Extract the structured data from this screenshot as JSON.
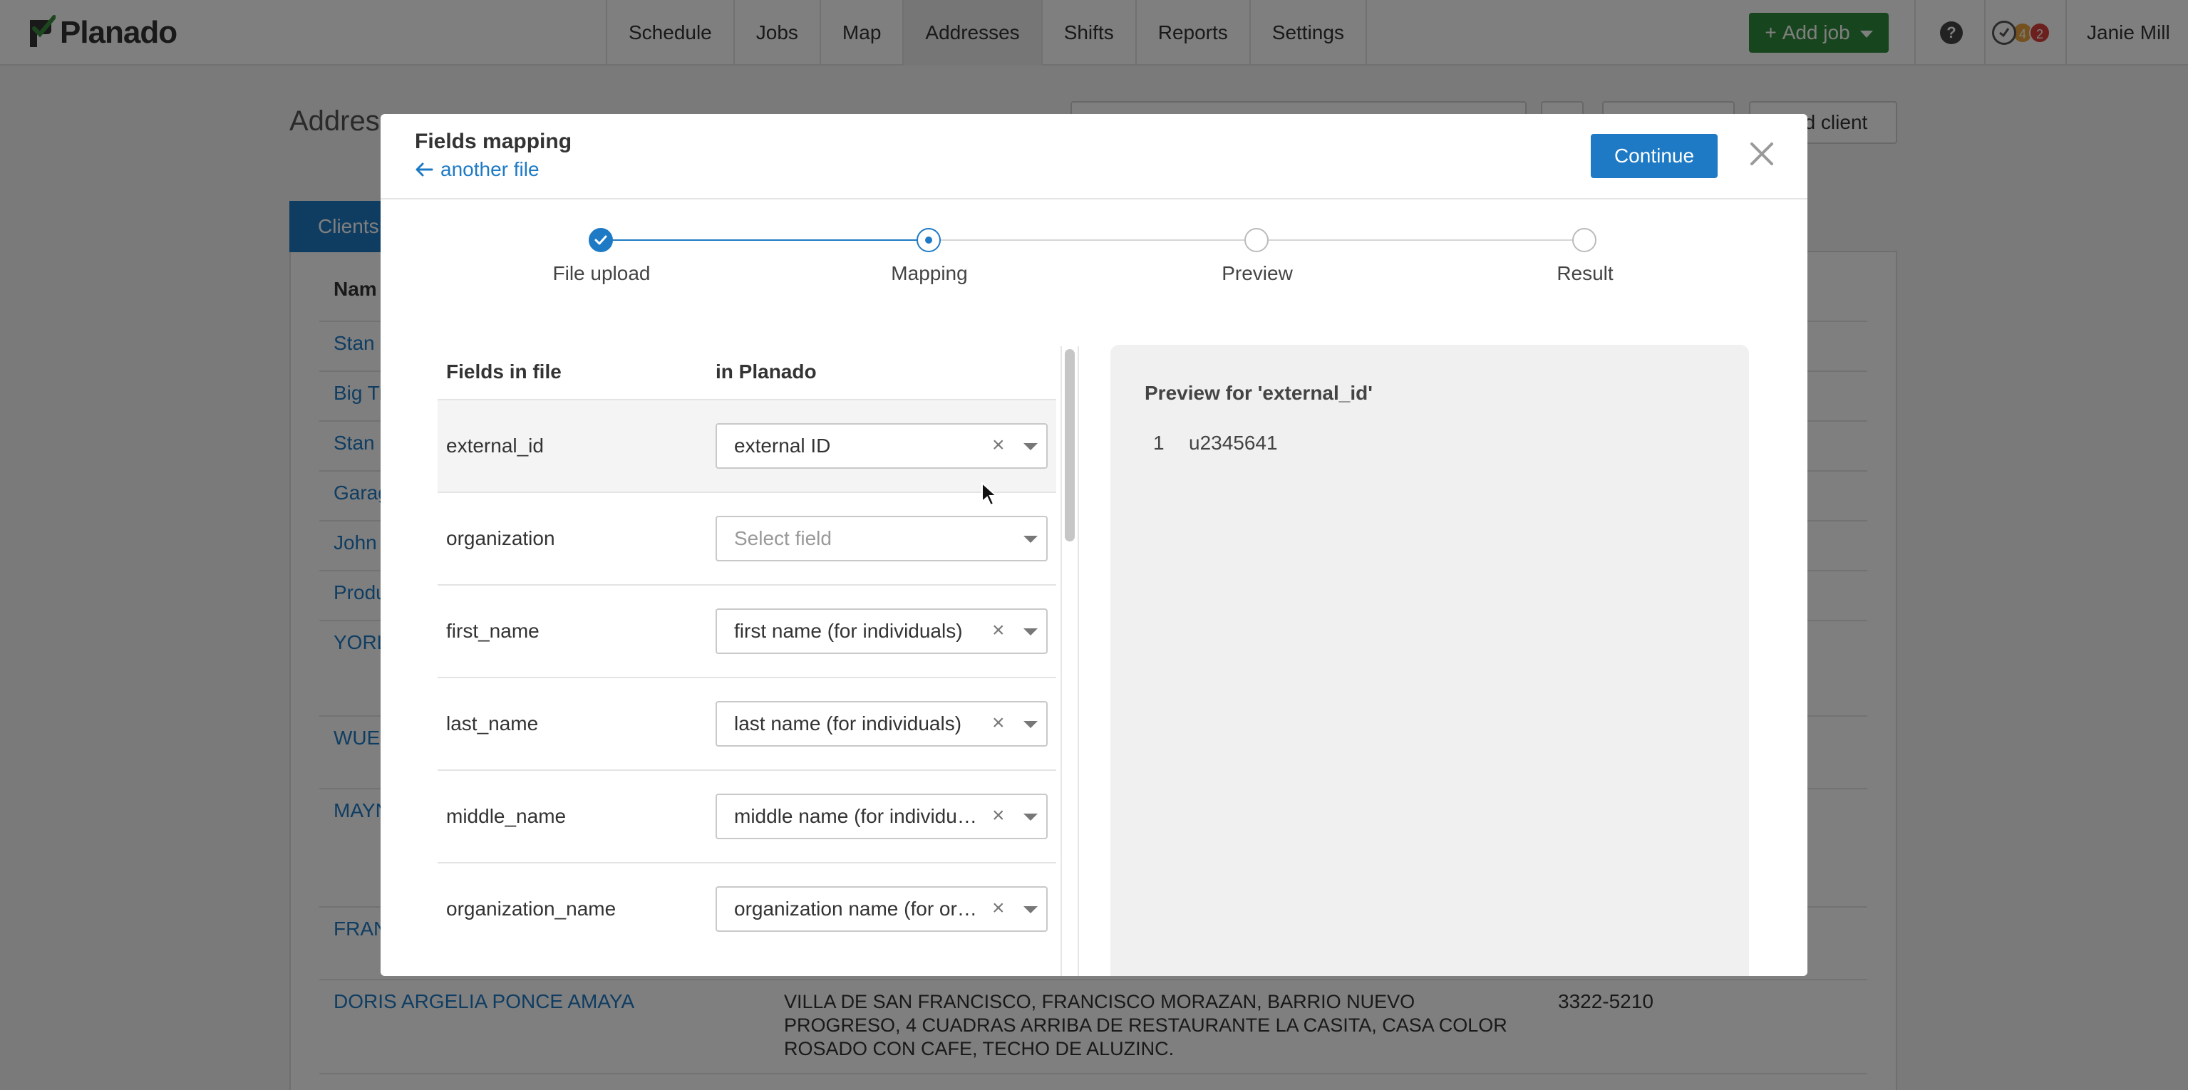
{
  "app": {
    "brand": "Planado"
  },
  "navbar": {
    "tabs": [
      "Schedule",
      "Jobs",
      "Map",
      "Addresses",
      "Shifts",
      "Reports",
      "Settings"
    ],
    "active_tab": "Addresses",
    "add_job_label": "Add job",
    "add_job_icon": "+",
    "help_icon": "?",
    "status_badges": {
      "orange": "4",
      "red": "2"
    },
    "user_name": "Janie Mill"
  },
  "background": {
    "page_title": "Addres",
    "add_client_label": "dd client",
    "clients_tab": "Clients",
    "table_header": "Nam",
    "rows": [
      {
        "name": "Stan I",
        "address": "",
        "phone": ""
      },
      {
        "name": "Big Tr",
        "address": "",
        "phone": ""
      },
      {
        "name": "Stan C",
        "address": "",
        "phone": ""
      },
      {
        "name": "Garag",
        "address": "",
        "phone": ""
      },
      {
        "name": "John I",
        "address": "",
        "phone": ""
      },
      {
        "name": "Produ",
        "address": "",
        "phone": ""
      },
      {
        "name": "YORL",
        "address": "",
        "phone": ""
      },
      {
        "name": "WUEN",
        "address": "",
        "phone": ""
      },
      {
        "name": "MAYN",
        "address": "",
        "phone": ""
      },
      {
        "name": "FRAN",
        "address": "",
        "phone": ""
      },
      {
        "name": "DORIS ARGELIA PONCE AMAYA",
        "address": "VILLA DE SAN FRANCISCO, FRANCISCO MORAZAN, BARRIO NUEVO PROGRESO, 4 CUADRAS ARRIBA DE RESTAURANTE LA CASITA, CASA COLOR ROSADO CON CAFE, TECHO DE ALUZINC.",
        "phone": "3322-5210"
      }
    ]
  },
  "modal": {
    "title": "Fields mapping",
    "back_link": "another file",
    "continue_label": "Continue",
    "steps": [
      {
        "label": "File upload",
        "state": "done"
      },
      {
        "label": "Mapping",
        "state": "current"
      },
      {
        "label": "Preview",
        "state": "todo"
      },
      {
        "label": "Result",
        "state": "todo"
      }
    ],
    "headers": {
      "file": "Fields in file",
      "planado": "in Planado"
    },
    "mappings": [
      {
        "field": "external_id",
        "value": "external ID",
        "placeholder": false
      },
      {
        "field": "organization",
        "value": "Select field",
        "placeholder": true
      },
      {
        "field": "first_name",
        "value": "first name (for individuals)",
        "placeholder": false
      },
      {
        "field": "last_name",
        "value": "last name (for individuals)",
        "placeholder": false
      },
      {
        "field": "middle_name",
        "value": "middle name (for individuals)",
        "placeholder": false
      },
      {
        "field": "organization_name",
        "value": "organization name (for organizations)",
        "placeholder": false
      }
    ],
    "preview": {
      "title": "Preview for 'external_id'",
      "rows": [
        {
          "index": "1",
          "value": "u2345641"
        }
      ]
    }
  },
  "colors": {
    "accent": "#1e7ac4",
    "success": "#2e8b3b",
    "brand_green": "#3a8d3e"
  }
}
